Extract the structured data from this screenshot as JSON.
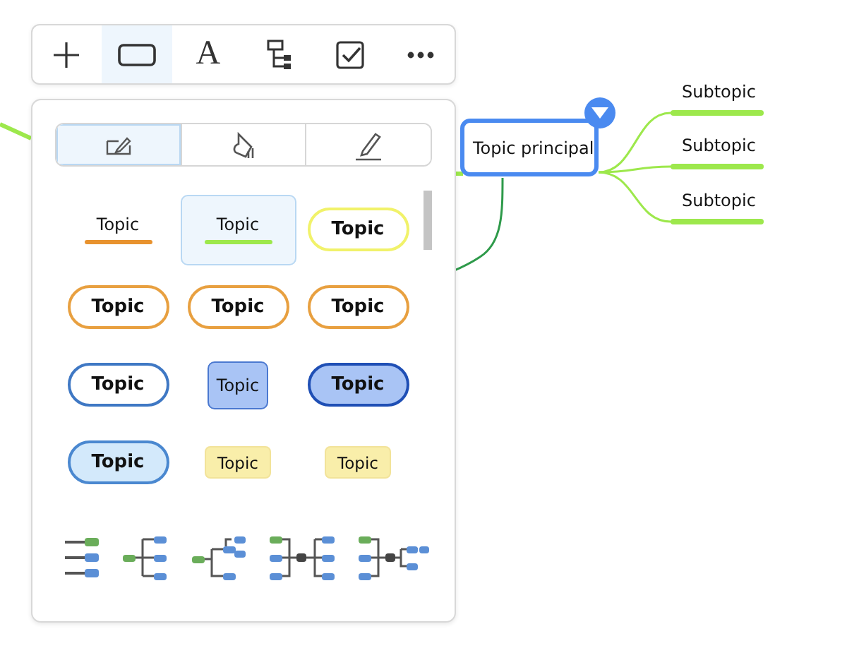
{
  "map": {
    "central_topic": "Topic principal",
    "collapsed": false,
    "subtopics": [
      "Subtopic",
      "Subtopic",
      "Subtopic"
    ]
  },
  "toolbar": [
    {
      "kind": "add",
      "selected": false
    },
    {
      "kind": "shape",
      "selected": true
    },
    {
      "kind": "text",
      "label": "A",
      "selected": false
    },
    {
      "kind": "structure",
      "selected": false
    },
    {
      "kind": "task",
      "selected": false
    },
    {
      "kind": "more",
      "selected": false
    }
  ],
  "panel": {
    "tabs": [
      {
        "kind": "shape",
        "selected": true
      },
      {
        "kind": "fill",
        "selected": false
      },
      {
        "kind": "border",
        "selected": false
      }
    ],
    "styles": [
      {
        "label": "Topic",
        "kind": "underline",
        "color": "#e8922e",
        "bold": false,
        "selected": false
      },
      {
        "label": "Topic",
        "kind": "underline",
        "color": "#9de84c",
        "bold": false,
        "selected": true
      },
      {
        "label": "Topic",
        "kind": "pill",
        "color": "#f1f26a",
        "bold": true,
        "selected": false
      },
      {
        "label": "Topic",
        "kind": "pill",
        "color": "#e8a040",
        "bold": true,
        "selected": false
      },
      {
        "label": "Topic",
        "kind": "pill",
        "color": "#e8a040",
        "bold": true,
        "selected": false
      },
      {
        "label": "Topic",
        "kind": "pill",
        "color": "#e8a040",
        "bold": true,
        "selected": false
      },
      {
        "label": "Topic",
        "kind": "pill",
        "color": "#3f78c4",
        "bold": true,
        "selected": false
      },
      {
        "label": "Topic",
        "kind": "square",
        "color": "#4a78d0",
        "bold": false,
        "selected": false
      },
      {
        "label": "Topic",
        "kind": "filled",
        "color": "#1f4fb5",
        "bold": true,
        "selected": false
      },
      {
        "label": "Topic",
        "kind": "soft",
        "color": "#4a88d0",
        "bold": true,
        "selected": false
      },
      {
        "label": "Topic",
        "kind": "tag",
        "color": "#f2e39a",
        "bold": false,
        "selected": false
      },
      {
        "label": "Topic",
        "kind": "tag",
        "color": "#f2e39a",
        "bold": false,
        "selected": false
      }
    ],
    "layouts": [
      {
        "kind": "list"
      },
      {
        "kind": "tree"
      },
      {
        "kind": "nested"
      },
      {
        "kind": "both"
      },
      {
        "kind": "both-nested"
      }
    ]
  }
}
